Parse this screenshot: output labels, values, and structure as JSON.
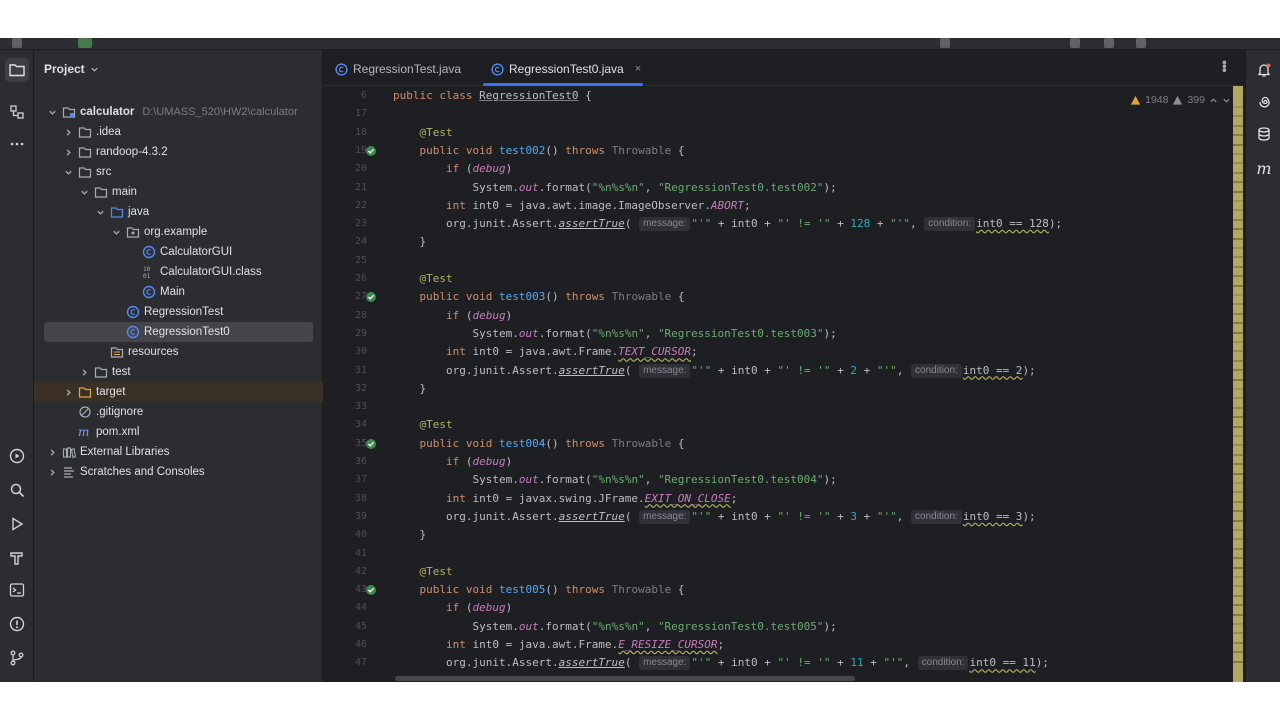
{
  "project_panel": {
    "title": "Project",
    "tree": [
      {
        "label": "calculator",
        "hint": "D:\\UMASS_520\\HW2\\calculator",
        "icon": "module-folder-icon",
        "depth": 0,
        "expanded": true,
        "bold": true
      },
      {
        "label": ".idea",
        "icon": "folder-icon",
        "depth": 1,
        "expanded": false
      },
      {
        "label": "randoop-4.3.2",
        "icon": "folder-icon",
        "depth": 1,
        "expanded": false
      },
      {
        "label": "src",
        "icon": "folder-icon",
        "depth": 1,
        "expanded": true
      },
      {
        "label": "main",
        "icon": "folder-icon",
        "depth": 2,
        "expanded": true
      },
      {
        "label": "java",
        "icon": "source-folder-icon",
        "depth": 3,
        "expanded": true
      },
      {
        "label": "org.example",
        "icon": "package-icon",
        "depth": 4,
        "expanded": true
      },
      {
        "label": "CalculatorGUI",
        "icon": "class-icon",
        "depth": 5
      },
      {
        "label": "CalculatorGUI.class",
        "icon": "binary-class-icon",
        "depth": 5
      },
      {
        "label": "Main",
        "icon": "class-icon",
        "depth": 5
      },
      {
        "label": "RegressionTest",
        "icon": "class-icon",
        "depth": 4
      },
      {
        "label": "RegressionTest0",
        "icon": "class-icon",
        "depth": 4,
        "selected": true
      },
      {
        "label": "resources",
        "icon": "resources-folder-icon",
        "depth": 3
      },
      {
        "label": "test",
        "icon": "folder-icon",
        "depth": 2,
        "expanded": false
      },
      {
        "label": "target",
        "icon": "excluded-folder-icon",
        "depth": 1,
        "expanded": false,
        "excluded": true
      },
      {
        "label": ".gitignore",
        "icon": "gitignore-icon",
        "depth": 1
      },
      {
        "label": "pom.xml",
        "icon": "maven-icon",
        "depth": 1
      },
      {
        "label": "External Libraries",
        "icon": "libraries-icon",
        "depth": 0,
        "expanded": false
      },
      {
        "label": "Scratches and Consoles",
        "icon": "scratches-icon",
        "depth": 0,
        "expanded": false
      }
    ]
  },
  "tabs": [
    {
      "label": "RegressionTest.java",
      "active": false
    },
    {
      "label": "RegressionTest0.java",
      "active": true,
      "close": "×"
    }
  ],
  "inspection": {
    "warnings": "1948",
    "weak_warnings": "399"
  },
  "line_numbers": [
    "6",
    "17",
    "18",
    "19",
    "20",
    "21",
    "22",
    "23",
    "24",
    "25",
    "26",
    "27",
    "28",
    "29",
    "30",
    "31",
    "32",
    "33",
    "34",
    "35",
    "36",
    "37",
    "38",
    "39",
    "40",
    "41",
    "42",
    "43",
    "44",
    "45",
    "46",
    "47"
  ],
  "run_gutter_lines": [
    "19",
    "27",
    "35",
    "43"
  ],
  "code": {
    "sticky": {
      "kw": "public class",
      "name": "RegressionTest0",
      "brace": "{"
    },
    "tests": [
      {
        "name": "test002",
        "ref_prefix": "java.awt.image.ImageObserver.",
        "ref_field": "ABORT",
        "value": "128",
        "cond": "int0 == 128"
      },
      {
        "name": "test003",
        "ref_prefix": "java.awt.Frame.",
        "ref_field": "TEXT_CURSOR",
        "value": "2",
        "cond": "int0 == 2"
      },
      {
        "name": "test004",
        "ref_prefix": "javax.swing.JFrame.",
        "ref_field": "EXIT_ON_CLOSE",
        "value": "3",
        "cond": "int0 == 3"
      },
      {
        "name": "test005",
        "ref_prefix": "java.awt.Frame.",
        "ref_field": "E_RESIZE_CURSOR",
        "value": "11",
        "cond": "int0 == 11"
      }
    ],
    "annotation": "@Test",
    "kw_public_void": "public void",
    "kw_throws": "throws",
    "throwable": "Throwable",
    "if_open": "if (",
    "debug": "debug",
    "if_close": ")",
    "sysout_a": "System.",
    "sysout_out": "out",
    "sysout_b": ".format(",
    "fmt": "\"%n%s%n\"",
    "sysout_str_prefix": "\"RegressionTest0.",
    "int_kw": "int",
    "int_decl": " int0 = ",
    "assert_prefix": "org.junit.Assert.",
    "assert_fn": "assertTrue",
    "hint_message": "message:",
    "hint_condition": "condition:",
    "msg_a": "\"'\"",
    "msg_b": " + int0 + ",
    "msg_c": "\"' != '\"",
    "msg_d": "\"'\""
  }
}
